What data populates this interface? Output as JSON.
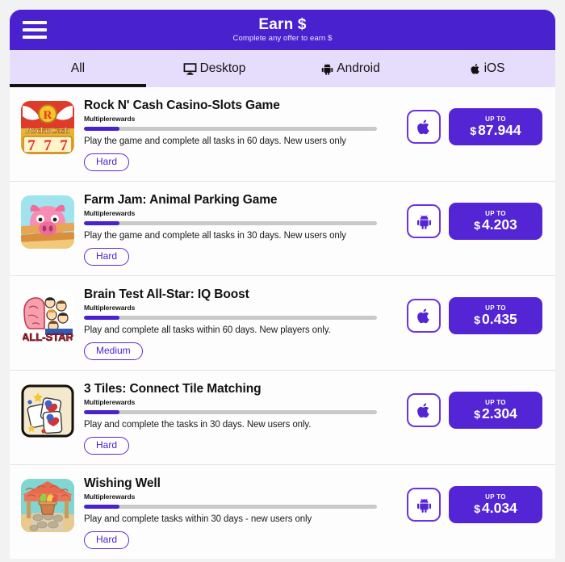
{
  "header": {
    "menu_icon": "hamburger-menu-icon",
    "title": "Earn $",
    "subtitle": "Complete any offer to earn $",
    "bg_color": "#4a21cf"
  },
  "tabs": {
    "active_index": 0,
    "bg_color": "#e6dcfb",
    "indicator_color": "#121212",
    "items": [
      {
        "label": "All",
        "icon": "",
        "active": true
      },
      {
        "label": "Desktop",
        "icon": "desktop-monitor-icon",
        "active": false
      },
      {
        "label": "Android",
        "icon": "android-robot-icon",
        "active": false
      },
      {
        "label": "iOS",
        "icon": "apple-logo-icon",
        "active": false
      }
    ]
  },
  "offers": [
    {
      "title": "Rock N' Cash Casino-Slots Game",
      "provider": "Multiplerewards",
      "description": "Play the game and complete all tasks in 60 days. New users only",
      "difficulty": "Hard",
      "platform": "apple-logo-icon",
      "progress_percent": 12,
      "reward_label": "UP TO",
      "reward_currency": "$",
      "reward_amount": "87.944",
      "thumbnail": "rock-n-cash-casino-thumbnail"
    },
    {
      "title": "Farm Jam: Animal Parking Game",
      "provider": "Multiplerewards",
      "description": "Play the game and complete all tasks in 30 days. New users only",
      "difficulty": "Hard",
      "platform": "android-robot-icon",
      "progress_percent": 12,
      "reward_label": "UP TO",
      "reward_currency": "$",
      "reward_amount": "4.203",
      "thumbnail": "farm-jam-pig-thumbnail"
    },
    {
      "title": "Brain Test All-Star: IQ Boost",
      "provider": "Multiplerewards",
      "description": "Play and complete all tasks within 60 days. New players only.",
      "difficulty": "Medium",
      "platform": "apple-logo-icon",
      "progress_percent": 12,
      "reward_label": "UP TO",
      "reward_currency": "$",
      "reward_amount": "0.435",
      "thumbnail": "brain-test-all-star-thumbnail"
    },
    {
      "title": "3 Tiles: Connect Tile Matching",
      "provider": "Multiplerewards",
      "description": "Play and complete the tasks in 30 days. New users only.",
      "difficulty": "Hard",
      "platform": "apple-logo-icon",
      "progress_percent": 12,
      "reward_label": "UP TO",
      "reward_currency": "$",
      "reward_amount": "2.304",
      "thumbnail": "three-tiles-thumbnail"
    },
    {
      "title": "Wishing Well",
      "provider": "Multiplerewards",
      "description": "Play and complete tasks within 30 days - new users only",
      "difficulty": "Hard",
      "platform": "android-robot-icon",
      "progress_percent": 12,
      "reward_label": "UP TO",
      "reward_currency": "$",
      "reward_amount": "4.034",
      "thumbnail": "wishing-well-thumbnail"
    }
  ],
  "colors": {
    "brand_purple": "#4a21cf",
    "reward_purple": "#5425d4",
    "tab_bg": "#e6dcfb",
    "progress_track": "#c9c9c9",
    "card_bg": "#fdfdfd"
  }
}
